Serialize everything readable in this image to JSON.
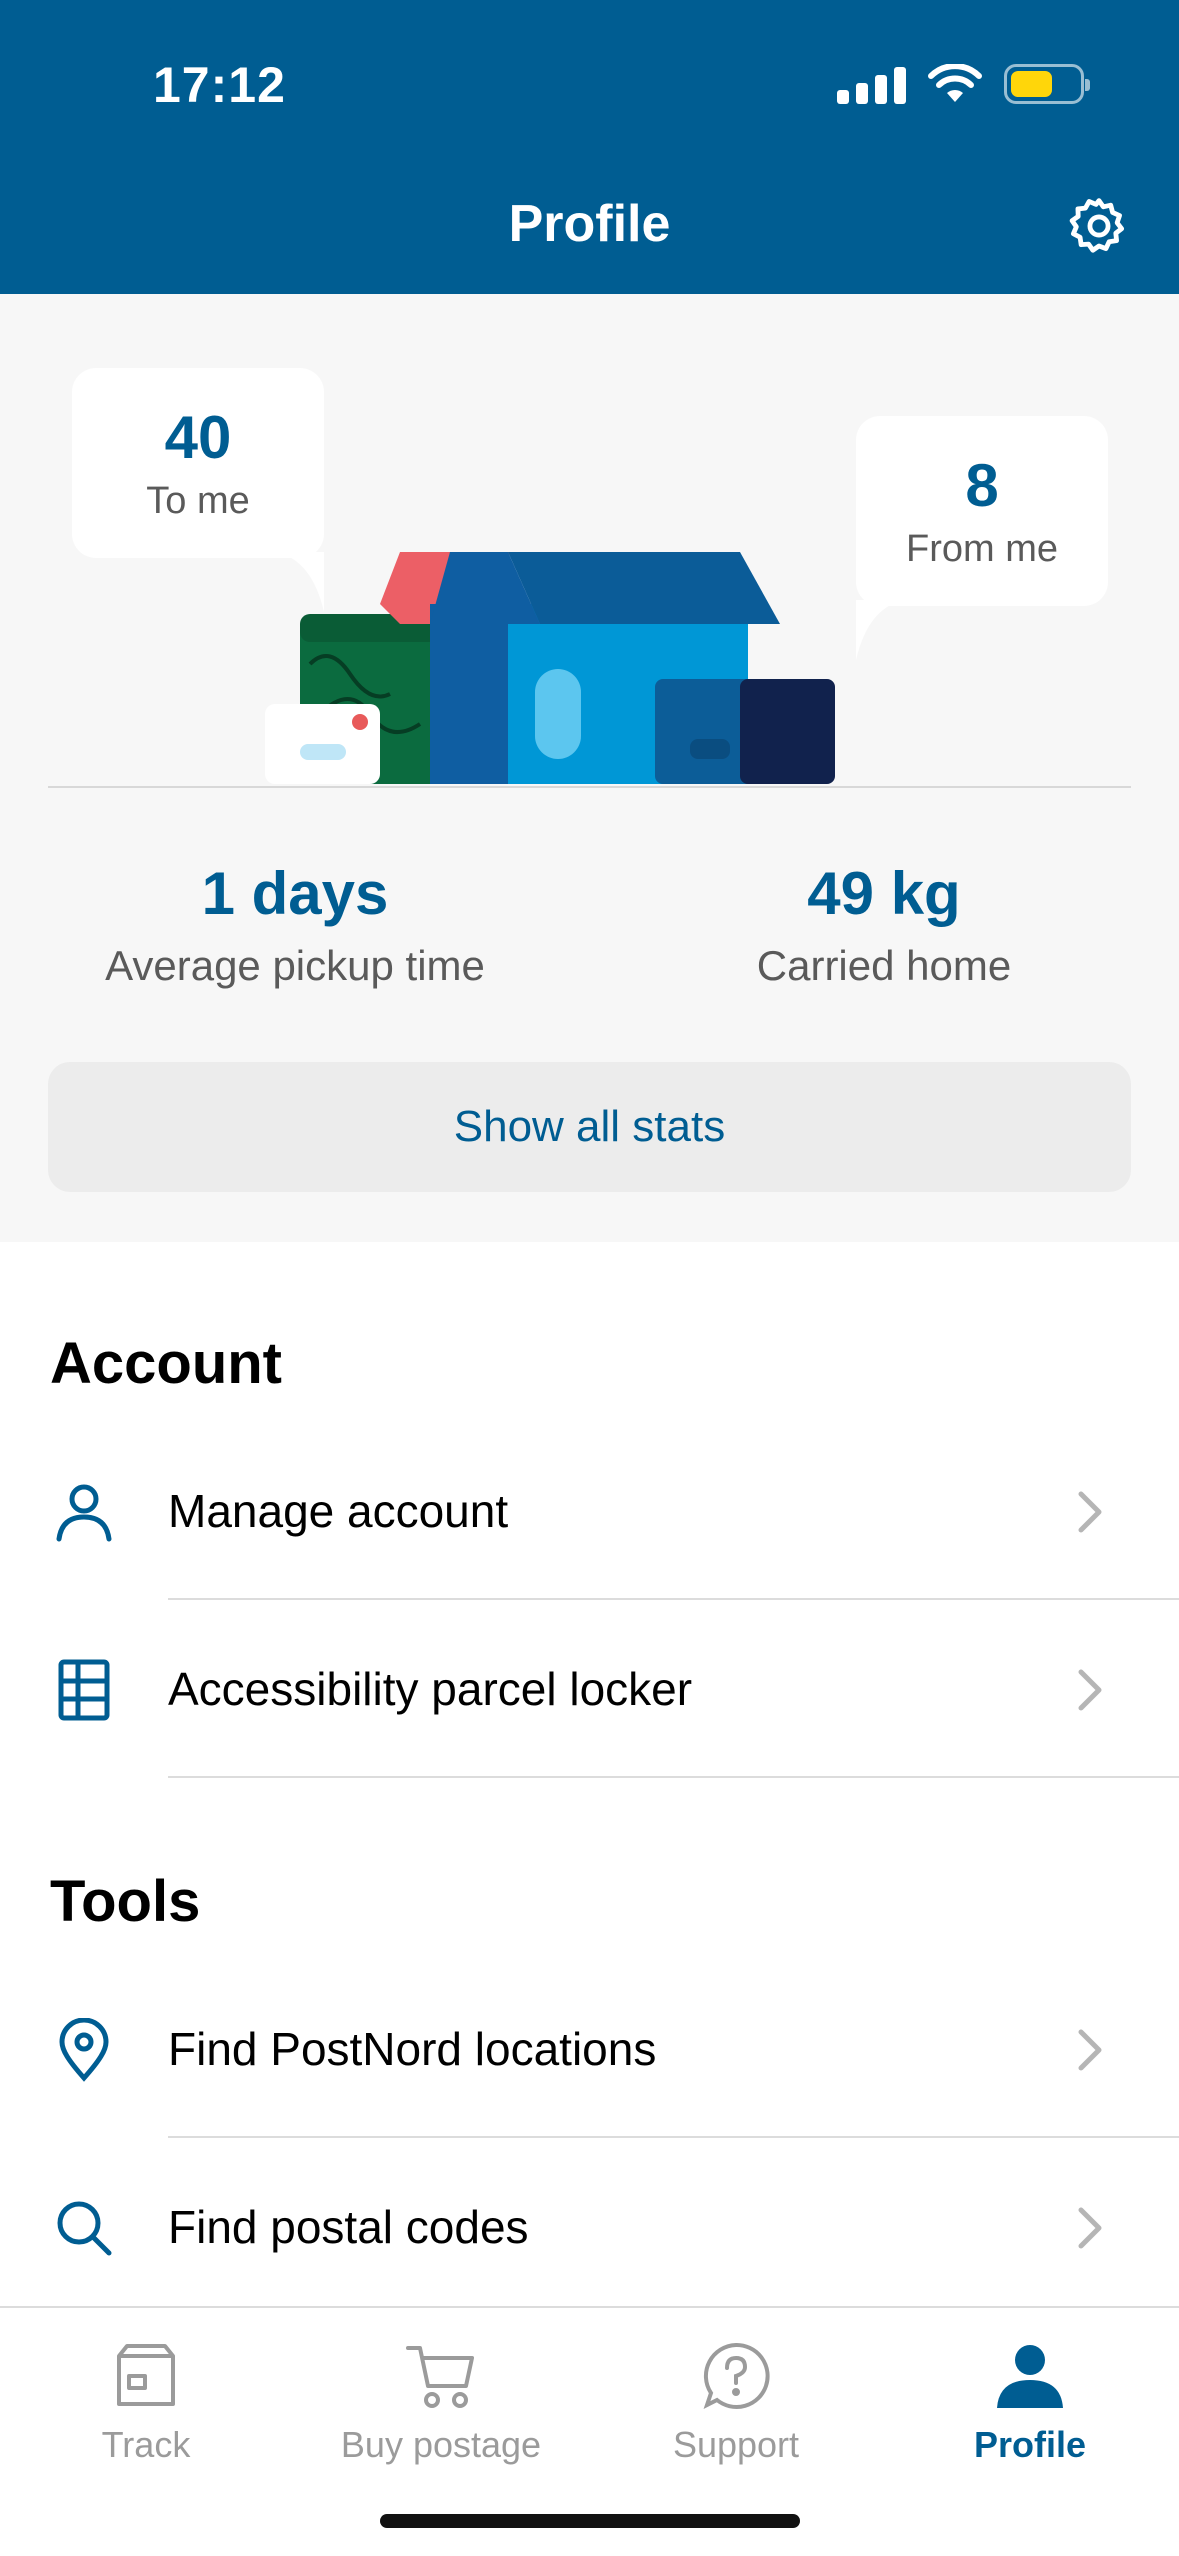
{
  "status_bar": {
    "time": "17:12"
  },
  "header": {
    "title": "Profile"
  },
  "stats": {
    "to_me": {
      "value": "40",
      "label": "To me"
    },
    "from_me": {
      "value": "8",
      "label": "From me"
    },
    "pickup": {
      "value": "1 days",
      "label": "Average pickup time"
    },
    "carried": {
      "value": "49 kg",
      "label": "Carried home"
    },
    "show_all_label": "Show all stats"
  },
  "account": {
    "title": "Account",
    "items": [
      {
        "label": "Manage account",
        "icon": "person-icon"
      },
      {
        "label": "Accessibility parcel locker",
        "icon": "locker-icon"
      }
    ]
  },
  "tools": {
    "title": "Tools",
    "items": [
      {
        "label": "Find PostNord locations",
        "icon": "location-pin-icon"
      },
      {
        "label": "Find postal codes",
        "icon": "search-icon"
      }
    ]
  },
  "tabbar": {
    "tabs": [
      {
        "label": "Track",
        "icon": "parcel-icon",
        "active": false
      },
      {
        "label": "Buy postage",
        "icon": "cart-icon",
        "active": false
      },
      {
        "label": "Support",
        "icon": "question-icon",
        "active": false
      },
      {
        "label": "Profile",
        "icon": "person-filled-icon",
        "active": true
      }
    ]
  },
  "colors": {
    "brand_blue": "#005d92",
    "battery_yellow": "#ffd60a",
    "background_gray": "#f7f7f7"
  }
}
